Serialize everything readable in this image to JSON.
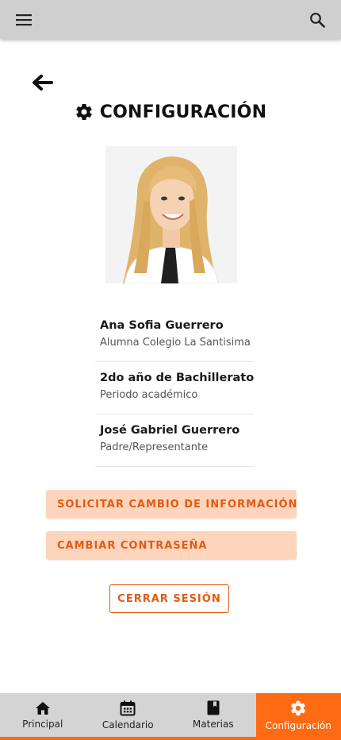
{
  "topbar": {
    "menu_icon": "menu-icon",
    "search_icon": "search-icon"
  },
  "back_icon": "arrow-left-icon",
  "title": {
    "icon": "gear-icon",
    "text": "CONFIGURACIÓN"
  },
  "profile_photo": "profile-photo",
  "info": [
    {
      "title": "Ana Sofia Guerrero",
      "subtitle": "Alumna Colegio La Santisima"
    },
    {
      "title": "2do año de Bachillerato",
      "subtitle": "Periodo académico"
    },
    {
      "title": "José Gabriel Guerrero",
      "subtitle": "Padre/Representante"
    }
  ],
  "buttons": {
    "request_change": "SOLICITAR CAMBIO DE INFORMACIÓN",
    "change_password": "CAMBIAR CONTRASEÑA",
    "logout": "CERRAR SESIÓN"
  },
  "nav": [
    {
      "label": "Principal",
      "icon": "home-icon",
      "active": false
    },
    {
      "label": "Calendario",
      "icon": "calendar-icon",
      "active": false
    },
    {
      "label": "Materias",
      "icon": "book-icon",
      "active": false
    },
    {
      "label": "Configuración",
      "icon": "gear-icon",
      "active": true
    }
  ],
  "colors": {
    "accent": "#ff6a13",
    "accent_text": "#e35a12",
    "soft_button": "#fdd5bd",
    "topbar": "#cfcfcf",
    "nav_bg": "#d4d4d4"
  }
}
